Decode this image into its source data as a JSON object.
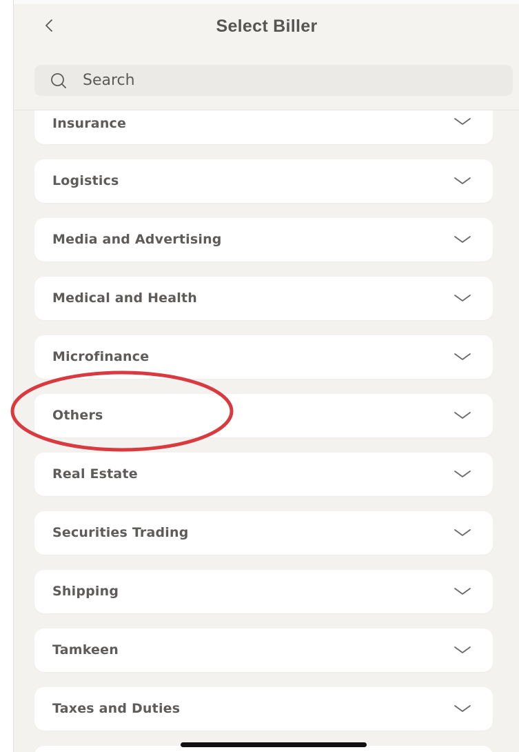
{
  "header": {
    "title": "Select Biller"
  },
  "search": {
    "placeholder": "Search",
    "value": ""
  },
  "categories": [
    "Insurance",
    "Logistics",
    "Media and Advertising",
    "Medical and Health",
    "Microfinance",
    "Others",
    "Real Estate",
    "Securities Trading",
    "Shipping",
    "Tamkeen",
    "Taxes and Duties"
  ],
  "annotation": {
    "highlighted_item": "Others",
    "color": "#d83a3f"
  },
  "colors": {
    "background": "#f3f2ef",
    "card": "#ffffff",
    "text": "#5e5c5a"
  },
  "icons": {
    "back": "chevron-left-icon",
    "search": "search-icon",
    "expand": "chevron-down-icon"
  }
}
